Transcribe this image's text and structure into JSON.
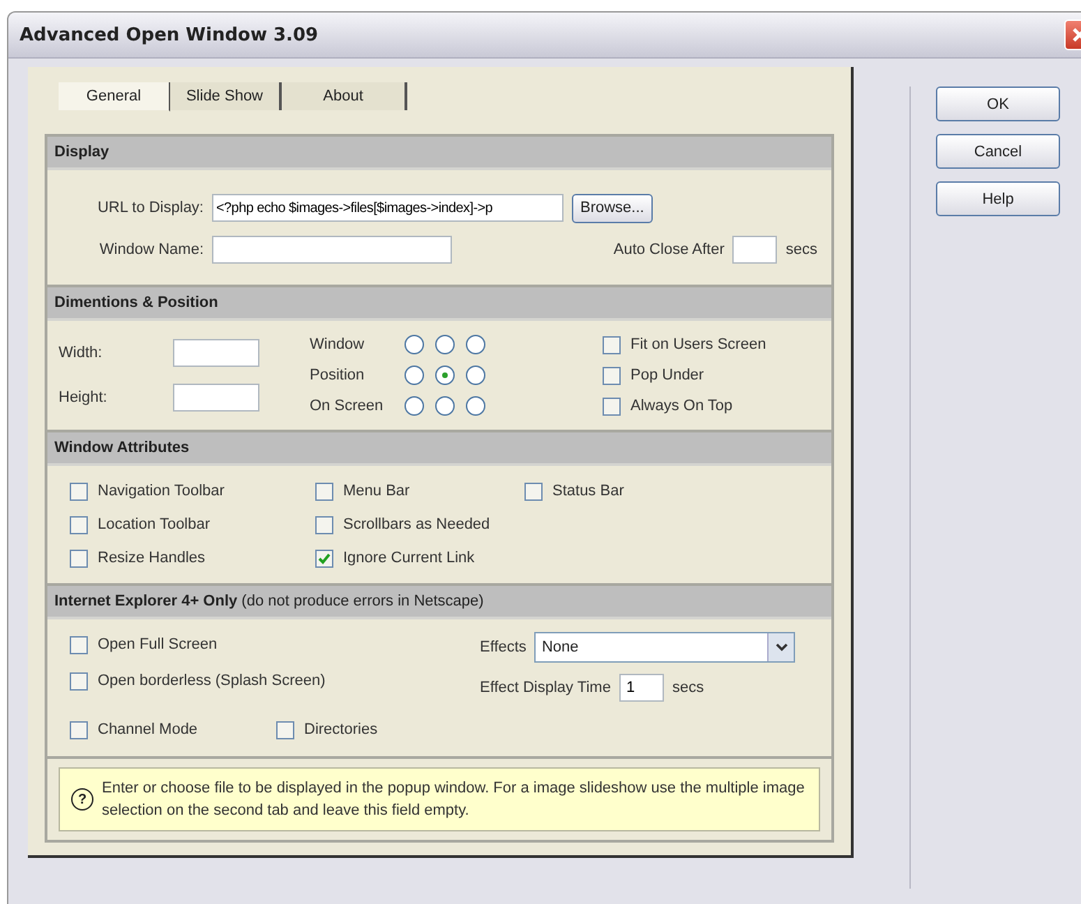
{
  "window": {
    "title": "Advanced Open Window 3.09"
  },
  "tabs": [
    {
      "label": "General",
      "selected": true
    },
    {
      "label": "Slide Show",
      "selected": false
    },
    {
      "label": "About",
      "selected": false
    }
  ],
  "display": {
    "header": "Display",
    "url_label": "URL to Display:",
    "url_value": "<?php echo $images->files[$images->index]->p",
    "browse_button": "Browse...",
    "name_label": "Window Name:",
    "auto_close_label": "Auto Close After",
    "auto_close_unit": "secs"
  },
  "dimensions": {
    "header": "Dimentions & Position",
    "width_label": "Width:",
    "height_label": "Height:",
    "position_labels": [
      "Window",
      "Position",
      "On Screen"
    ],
    "position_grid": [
      {
        "selected": false
      },
      {
        "selected": false
      },
      {
        "selected": false
      },
      {
        "selected": false
      },
      {
        "selected": true
      },
      {
        "selected": false
      },
      {
        "selected": false
      },
      {
        "selected": false
      },
      {
        "selected": false
      }
    ],
    "options": [
      {
        "label": "Fit on Users Screen",
        "checked": false
      },
      {
        "label": "Pop Under",
        "checked": false
      },
      {
        "label": "Always On Top",
        "checked": false
      }
    ]
  },
  "attributes": {
    "header": "Window Attributes",
    "items": [
      {
        "label": "Navigation Toolbar",
        "checked": false
      },
      {
        "label": "Menu Bar",
        "checked": false
      },
      {
        "label": "Status Bar",
        "checked": false
      },
      {
        "label": "Location Toolbar",
        "checked": false
      },
      {
        "label": "Scrollbars as Needed",
        "checked": false
      },
      {
        "label": "Resize Handles",
        "checked": false
      },
      {
        "label": "Ignore Current Link",
        "checked": true
      }
    ]
  },
  "ie": {
    "header": "**Internet Explorer 4+ Only** (do not produce errors in Netscape)",
    "options": [
      {
        "label": "Open Full Screen",
        "checked": false
      },
      {
        "label": "Open borderless (Splash Screen)",
        "checked": false
      }
    ],
    "bottom_options": [
      {
        "label": "Channel Mode",
        "checked": false
      },
      {
        "label": "Directories",
        "checked": false
      }
    ],
    "effects_label": "Effects",
    "effects_value": "None",
    "time_label": "Effect Display Time",
    "time_value": "1",
    "time_unit": "secs"
  },
  "note": {
    "icon": "?",
    "text": "Enter or choose file to be displayed in the popup window. For a image slideshow use the multiple image selection on the second tab and leave this field empty."
  },
  "buttons": [
    "OK",
    "Cancel",
    "Help"
  ]
}
